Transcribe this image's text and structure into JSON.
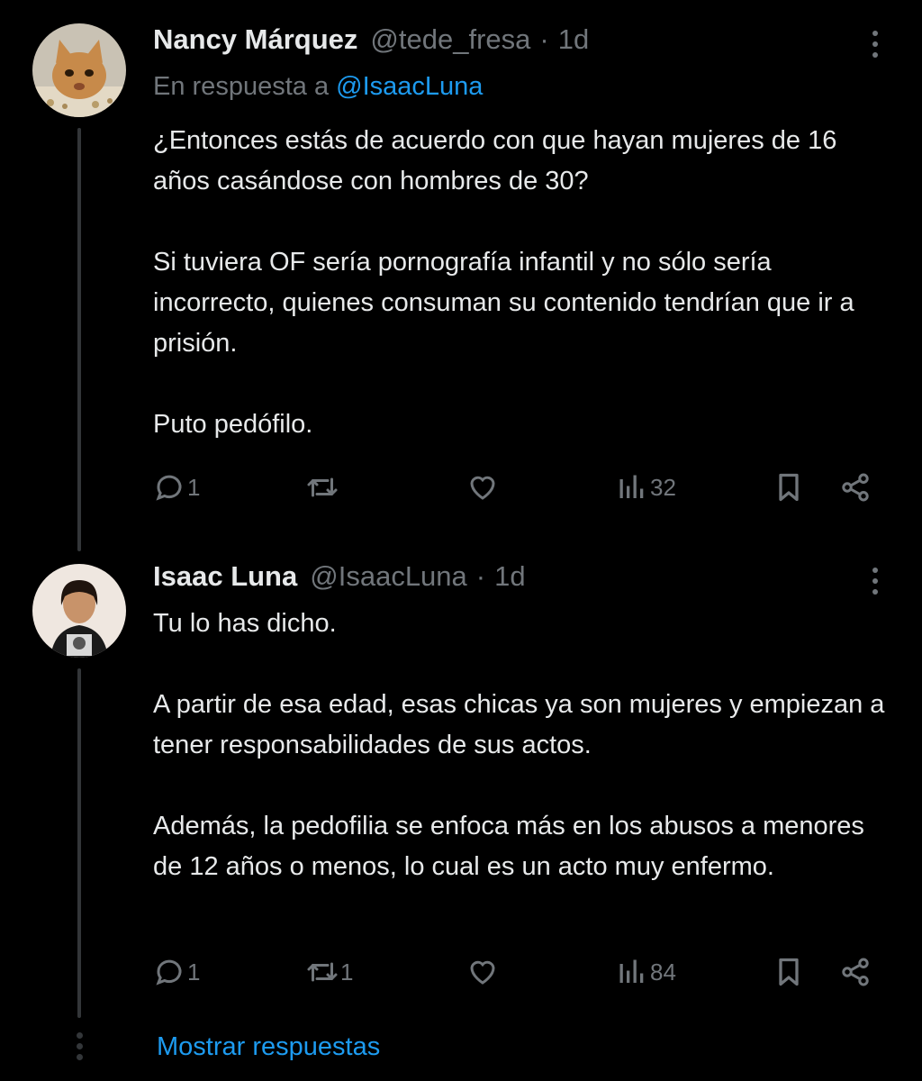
{
  "tweets": [
    {
      "name": "Nancy Márquez",
      "handle": "@tede_fresa",
      "separator": "·",
      "time": "1d",
      "reply_prefix": "En respuesta a",
      "reply_handle": "@IsaacLuna",
      "paragraphs": [
        "¿Entonces estás de acuerdo con que hayan mujeres de 16 años casándose con hombres de 30?",
        "Si tuviera OF sería pornografía infantil y no sólo sería incorrecto, quienes consuman su contenido tendrían que ir a prisión.",
        "Puto pedófilo."
      ],
      "reply_count": "1",
      "retweet_count": "",
      "like_count": "",
      "view_count": "32"
    },
    {
      "name": "Isaac Luna",
      "handle": "@IsaacLuna",
      "separator": "·",
      "time": "1d",
      "paragraphs": [
        "Tu lo has dicho.",
        "A partir de esa edad, esas chicas ya son mujeres y empiezan a tener responsabilidades de sus actos.",
        "Además, la pedofilia se enfoca más en los abusos a menores de 12 años o menos, lo cual es un acto muy enfermo."
      ],
      "reply_count": "1",
      "retweet_count": "1",
      "like_count": "",
      "view_count": "84"
    }
  ],
  "show_replies_label": "Mostrar respuestas",
  "colors": {
    "background": "#000000",
    "text": "#e7e9ea",
    "muted": "#71767b",
    "accent": "#1d9bf0",
    "line": "#333639"
  }
}
